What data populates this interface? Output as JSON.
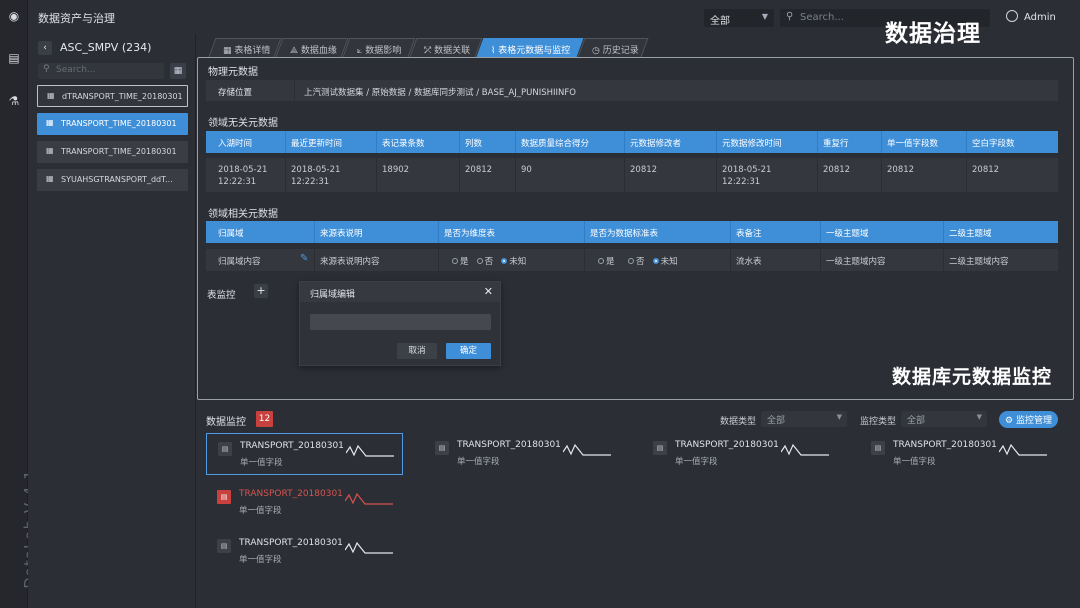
{
  "app": {
    "title": "数据资产与治理",
    "version": "DataLab V 4.1",
    "overlay_title": "数据治理",
    "overlay_subtitle": "数据库元数据监控"
  },
  "topbar": {
    "scope_select": "全部",
    "search_placeholder": "Search...",
    "user": "Admin"
  },
  "sidebar": {
    "db_name": "ASC_SMPV (234)",
    "search_placeholder": "Search...",
    "tables": [
      {
        "name": "dTRANSPORT_TIME_20180301"
      },
      {
        "name": "TRANSPORT_TIME_20180301"
      },
      {
        "name": "TRANSPORT_TIME_20180301"
      },
      {
        "name": "SYUAHSGTRANSPORT_ddT..."
      }
    ]
  },
  "tabs": [
    {
      "label": "表格详情"
    },
    {
      "label": "数据血缘"
    },
    {
      "label": "数据影响"
    },
    {
      "label": "数据关联"
    },
    {
      "label": "表格元数据与监控"
    },
    {
      "label": "历史记录"
    }
  ],
  "physical_meta": {
    "title": "物理元数据",
    "storage_label": "存储位置",
    "storage_path": "上汽测试数据集 / 原始数据 / 数据库同步测试 / BASE_AJ_PUNISHIINFO"
  },
  "domain_free": {
    "title": "领域无关元数据",
    "headers": [
      "入湖时间",
      "最近更新时间",
      "表记录条数",
      "列数",
      "数据质量综合得分",
      "元数据修改者",
      "元数据修改时间",
      "重复行",
      "单一值字段数",
      "空白字段数"
    ],
    "row": {
      "c0a": "2018-05-21",
      "c0b": "12:22:31",
      "c1a": "2018-05-21",
      "c1b": "12:22:31",
      "c2": "18902",
      "c3": "20812",
      "c4": "90",
      "c5": "20812",
      "c6a": "2018-05-21",
      "c6b": "12:22:31",
      "c7": "20812",
      "c8": "20812",
      "c9": "20812"
    }
  },
  "domain_rel": {
    "title": "领域相关元数据",
    "headers": [
      "归属域",
      "来源表说明",
      "是否为维度表",
      "是否为数据标准表",
      "表备注",
      "一级主题域",
      "二级主题域"
    ],
    "row": {
      "c0": "归属域内容",
      "c1": "来源表说明内容",
      "yes": "是",
      "no": "否",
      "unknown": "未知",
      "c4": "流水表",
      "c5": "一级主题域内容",
      "c6": "二级主题域内容"
    }
  },
  "table_monitor": {
    "label": "表监控",
    "add": "+"
  },
  "dialog": {
    "title": "归属域编辑",
    "input_value": "",
    "cancel": "取消",
    "ok": "确定"
  },
  "monitor": {
    "title": "数据监控",
    "count": "12",
    "type_label": "数据类型",
    "type_value": "全部",
    "mtype_label": "监控类型",
    "mtype_value": "全部",
    "manage": "监控管理",
    "cards": [
      {
        "name": "TRANSPORT_20180301",
        "sub": "单一值字段",
        "state": "selected"
      },
      {
        "name": "TRANSPORT_20180301",
        "sub": "单一值字段",
        "state": "normal"
      },
      {
        "name": "TRANSPORT_20180301",
        "sub": "单一值字段",
        "state": "normal"
      },
      {
        "name": "TRANSPORT_20180301",
        "sub": "单一值字段",
        "state": "normal"
      },
      {
        "name": "TRANSPORT_20180301",
        "sub": "单一值字段",
        "state": "alert"
      },
      {
        "name": "TRANSPORT_20180301",
        "sub": "单一值字段",
        "state": "normal"
      }
    ]
  },
  "colors": {
    "accent": "#3f8fd8",
    "alert": "#c9413f",
    "bg": "#2b2e35"
  }
}
